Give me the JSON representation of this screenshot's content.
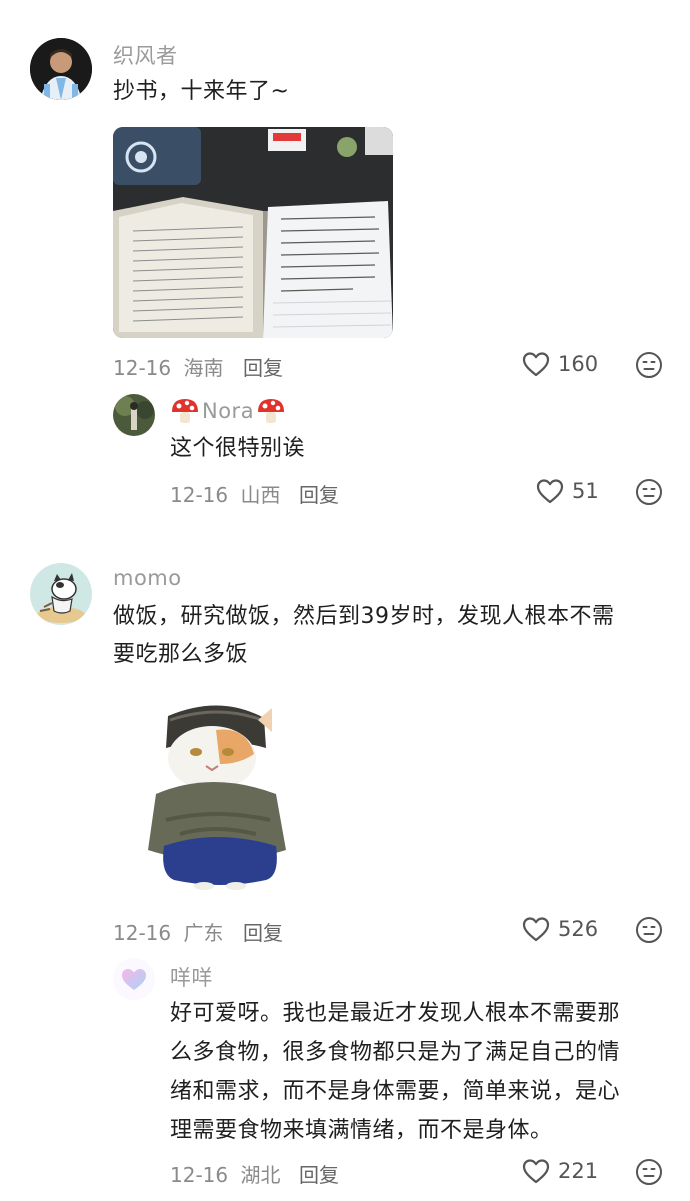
{
  "comments": [
    {
      "username": "织风者",
      "text": "抄书，十来年了~",
      "date": "12-16",
      "location": "海南",
      "reply_label": "回复",
      "likes": "160",
      "replies": [
        {
          "username": "Nora",
          "text": "这个很特别诶",
          "date": "12-16",
          "location": "山西",
          "reply_label": "回复",
          "likes": "51"
        }
      ]
    },
    {
      "username": "momo",
      "text_line1": "做饭，研究做饭，然后到39岁时，发现人根本不需",
      "text_line2": "要吃那么多饭",
      "date": "12-16",
      "location": "广东",
      "reply_label": "回复",
      "likes": "526",
      "replies": [
        {
          "username": "咩咩",
          "lines": [
            "好可爱呀。我也是最近才发现人根本不需要那",
            "么多食物，很多食物都只是为了满足自己的情",
            "绪和需求，而不是身体需要，简单来说，是心",
            "理需要食物来填满情绪，而不是身体。"
          ],
          "date": "12-16",
          "location": "湖北",
          "reply_label": "回复",
          "likes": "221"
        }
      ]
    }
  ],
  "icons": {
    "like": "heart-outline-icon",
    "dislike": "unhappy-face-icon",
    "mushroom": "mushroom-emoji-icon"
  }
}
